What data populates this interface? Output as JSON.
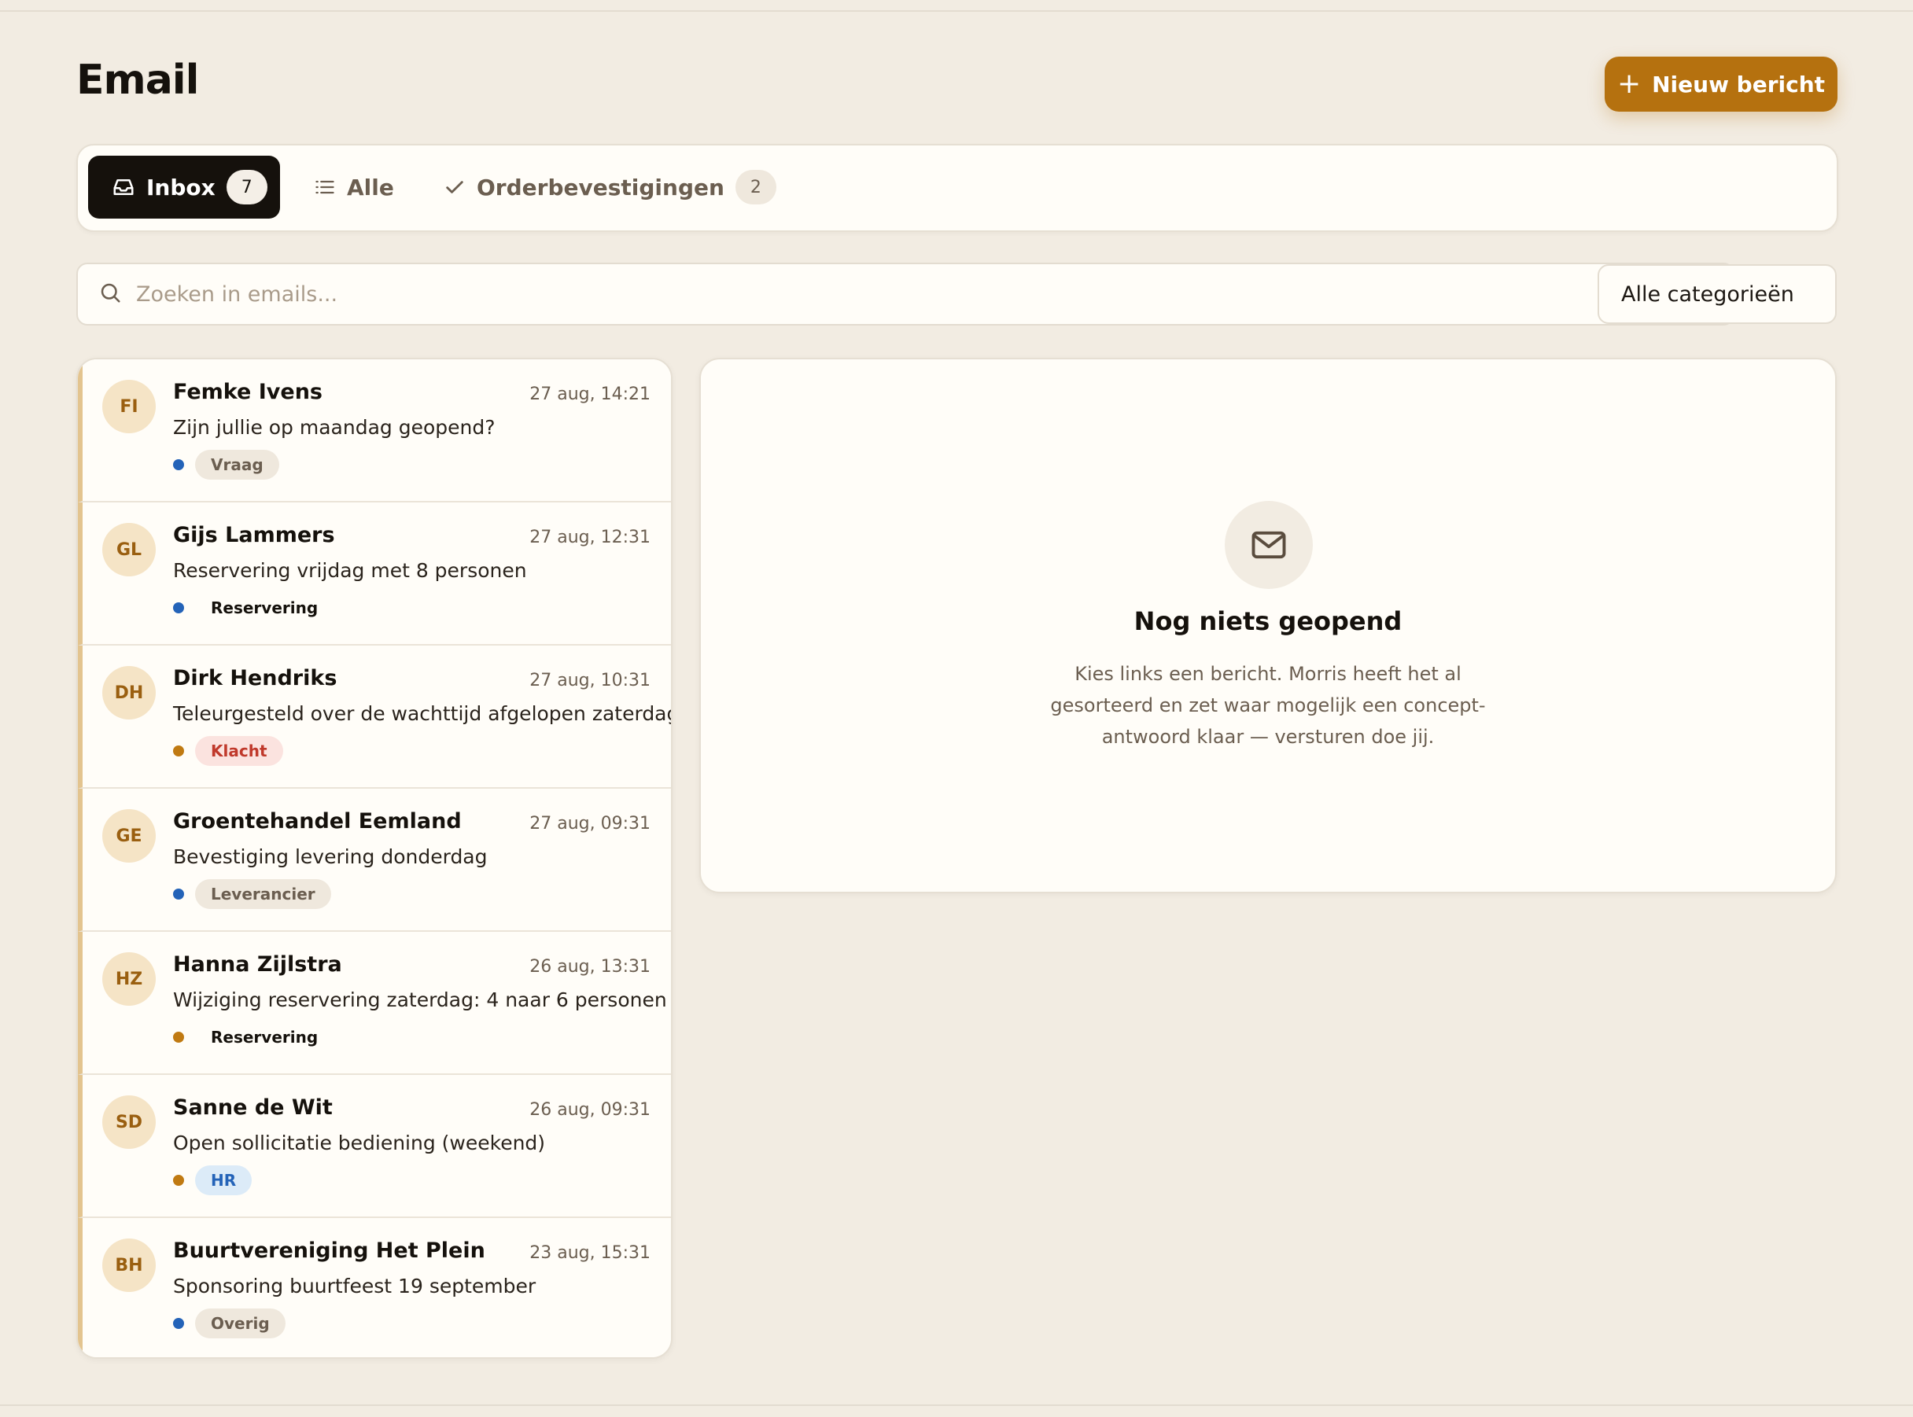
{
  "page": {
    "title": "Email"
  },
  "toolbar": {
    "new_message_label": "Nieuw bericht"
  },
  "tabs": [
    {
      "label": "Inbox",
      "count": "7",
      "icon": "inbox-icon",
      "active": true
    },
    {
      "label": "Alle",
      "icon": "list-icon"
    },
    {
      "label": "Orderbevestigingen",
      "count": "2",
      "icon": "check-icon"
    }
  ],
  "search": {
    "placeholder": "Zoeken in emails..."
  },
  "category_filter": {
    "selected": "Alle categorieën"
  },
  "colors": {
    "accent": "#b5710f",
    "dot_blue": "#2463b8",
    "dot_orange": "#c07a12",
    "badge_neutral_bg": "#efe8dd",
    "badge_neutral_fg": "#6b5e50",
    "badge_red_bg": "#fbe3df",
    "badge_red_fg": "#c0392b",
    "badge_blue_bg": "#dcebf8",
    "badge_blue_fg": "#2463b8",
    "badge_plain_fg": "#15110c"
  },
  "emails": [
    {
      "initials": "FI",
      "sender": "Femke Ivens",
      "time": "27 aug, 14:21",
      "subject": "Zijn jullie op maandag geopend?",
      "category": "Vraag",
      "dot": "blue",
      "badge_style": "neutral"
    },
    {
      "initials": "GL",
      "sender": "Gijs Lammers",
      "time": "27 aug, 12:31",
      "subject": "Reservering vrijdag met 8 personen",
      "category": "Reservering",
      "dot": "blue",
      "badge_style": "plain"
    },
    {
      "initials": "DH",
      "sender": "Dirk Hendriks",
      "time": "27 aug, 10:31",
      "subject": "Teleurgesteld over de wachttijd afgelopen zaterdag",
      "category": "Klacht",
      "dot": "orange",
      "badge_style": "red"
    },
    {
      "initials": "GE",
      "sender": "Groentehandel Eemland",
      "time": "27 aug, 09:31",
      "subject": "Bevestiging levering donderdag",
      "category": "Leverancier",
      "dot": "blue",
      "badge_style": "neutral"
    },
    {
      "initials": "HZ",
      "sender": "Hanna Zijlstra",
      "time": "26 aug, 13:31",
      "subject": "Wijziging reservering zaterdag: 4 naar 6 personen",
      "category": "Reservering",
      "dot": "orange",
      "badge_style": "plain"
    },
    {
      "initials": "SD",
      "sender": "Sanne de Wit",
      "time": "26 aug, 09:31",
      "subject": "Open sollicitatie bediening (weekend)",
      "category": "HR",
      "dot": "orange",
      "badge_style": "blue"
    },
    {
      "initials": "BH",
      "sender": "Buurtvereniging Het Plein",
      "time": "23 aug, 15:31",
      "subject": "Sponsoring buurtfeest 19 september",
      "category": "Overig",
      "dot": "blue",
      "badge_style": "neutral"
    }
  ],
  "preview": {
    "icon": "mail-icon",
    "title": "Nog niets geopend",
    "text": "Kies links een bericht. Morris heeft het al gesorteerd en zet waar mogelijk een concept-antwoord klaar — versturen doe jij."
  }
}
